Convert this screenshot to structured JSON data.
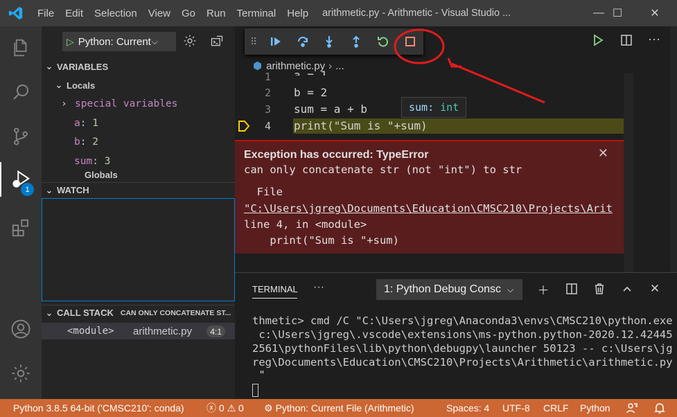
{
  "titlebar": {
    "menus": [
      {
        "label": "File"
      },
      {
        "label": "Edit"
      },
      {
        "label": "Selection"
      },
      {
        "label": "View"
      },
      {
        "label": "Go"
      },
      {
        "label": "Run"
      },
      {
        "label": "Terminal"
      },
      {
        "label": "Help"
      }
    ],
    "window_title": "arithmetic.py - Arithmetic - Visual Studio ...",
    "controls": {
      "minimize": "—",
      "maximize": "☐",
      "close": "✕"
    }
  },
  "activitybar": {
    "icons": [
      "explorer-icon",
      "search-icon",
      "source-control-icon",
      "run-debug-icon",
      "extensions-icon",
      "account-icon",
      "manage-gear-icon"
    ],
    "debug_badge": "1"
  },
  "sidebar": {
    "debug_config": "Python: Current File (Arithmetic)",
    "variables_header": "VARIABLES",
    "locals_header": "Locals",
    "special_variables": "special variables",
    "variables": [
      {
        "name": "a",
        "value": "1"
      },
      {
        "name": "b",
        "value": "2"
      },
      {
        "name": "sum",
        "value": "3"
      }
    ],
    "globals_partial": "Globals",
    "watch_header": "WATCH",
    "callstack_header": "CALL STACK",
    "callstack_status": "CAN ONLY CONCATENATE ST...",
    "callstack_frame": {
      "name": "<module>",
      "file": "arithmetic.py",
      "line": "4:1"
    }
  },
  "editor": {
    "breadcrumb": {
      "file": "arithmetic.py",
      "more": "..."
    },
    "lines": [
      {
        "num": "1",
        "code": "a = 1"
      },
      {
        "num": "2",
        "code": "b = 2"
      },
      {
        "num": "3",
        "code": "sum = a + b"
      },
      {
        "num": "4",
        "code": "print(\"Sum is \"+sum)"
      }
    ],
    "hover": {
      "name": "sum:",
      "type": "int"
    },
    "exception": {
      "title": "Exception has occurred: TypeError",
      "message": "can only concatenate str (not \"int\") to str",
      "file_label": "  File",
      "path": "\"C:\\Users\\jgreg\\Documents\\Education\\CMSC210\\Projects\\Arit",
      "location": "line 4, in <module>",
      "code": "    print(\"Sum is \"+sum)",
      "close": "✕"
    }
  },
  "panel": {
    "tab": "TERMINAL",
    "more": "···",
    "terminal_select": "1: Python Debug Consc",
    "output": [
      "thmetic> cmd /C \"C:\\Users\\jgreg\\Anaconda3\\envs\\CMSC210\\python.exe",
      " c:\\Users\\jgreg\\.vscode\\extensions\\ms-python.python-2020.12.42445",
      "2561\\pythonFiles\\lib\\python\\debugpy\\launcher 50123 -- c:\\Users\\jg",
      "reg\\Documents\\Education\\CMSC210\\Projects\\Arithmetic\\arithmetic.py",
      " \""
    ]
  },
  "statusbar": {
    "interpreter": "Python 3.8.5 64-bit ('CMSC210': conda)",
    "errors": "0",
    "warnings": "0",
    "debug_config": "Python: Current File (Arithmetic)",
    "spaces": "Spaces: 4",
    "encoding": "UTF-8",
    "eol": "CRLF",
    "language": "Python",
    "color": "#cc6633"
  },
  "colors": {
    "accent": "#007acc",
    "exception_bg": "#5a1d1d",
    "annotation": "#e21b1b"
  }
}
